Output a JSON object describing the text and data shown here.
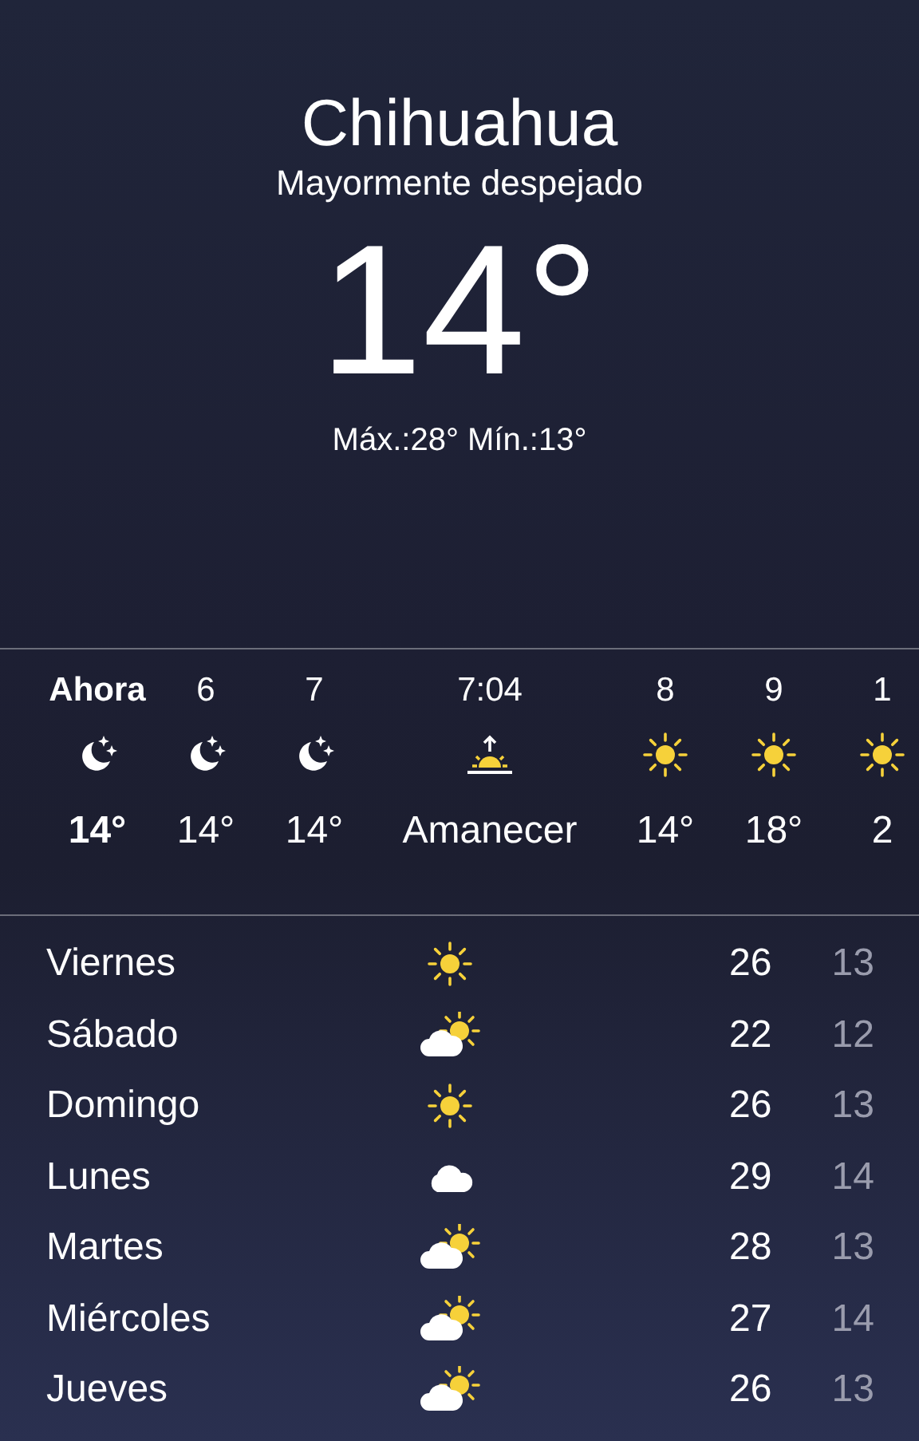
{
  "location": {
    "city": "Chihuahua",
    "condition": "Mayormente despejado",
    "temperature": "14°",
    "high_low": "Máx.:28° Mín.:13°"
  },
  "hourly": [
    {
      "time": "Ahora",
      "kind": "moon",
      "value": "14°",
      "now": true
    },
    {
      "time": "6",
      "kind": "moon",
      "value": "14°",
      "now": false
    },
    {
      "time": "7",
      "kind": "moon",
      "value": "14°",
      "now": false
    },
    {
      "time": "7:04",
      "kind": "sunrise",
      "value": "Amanecer",
      "now": false
    },
    {
      "time": "8",
      "kind": "sun",
      "value": "14°",
      "now": false
    },
    {
      "time": "9",
      "kind": "sun",
      "value": "18°",
      "now": false
    },
    {
      "time": "1",
      "kind": "sun",
      "value": "2",
      "now": false
    }
  ],
  "daily": [
    {
      "day": "Viernes",
      "kind": "sun",
      "high": "26",
      "low": "13"
    },
    {
      "day": "Sábado",
      "kind": "partly",
      "high": "22",
      "low": "12"
    },
    {
      "day": "Domingo",
      "kind": "sun",
      "high": "26",
      "low": "13"
    },
    {
      "day": "Lunes",
      "kind": "cloud",
      "high": "29",
      "low": "14"
    },
    {
      "day": "Martes",
      "kind": "partly",
      "high": "28",
      "low": "13"
    },
    {
      "day": "Miércoles",
      "kind": "partly",
      "high": "27",
      "low": "14"
    },
    {
      "day": "Jueves",
      "kind": "partly",
      "high": "26",
      "low": "13"
    }
  ]
}
